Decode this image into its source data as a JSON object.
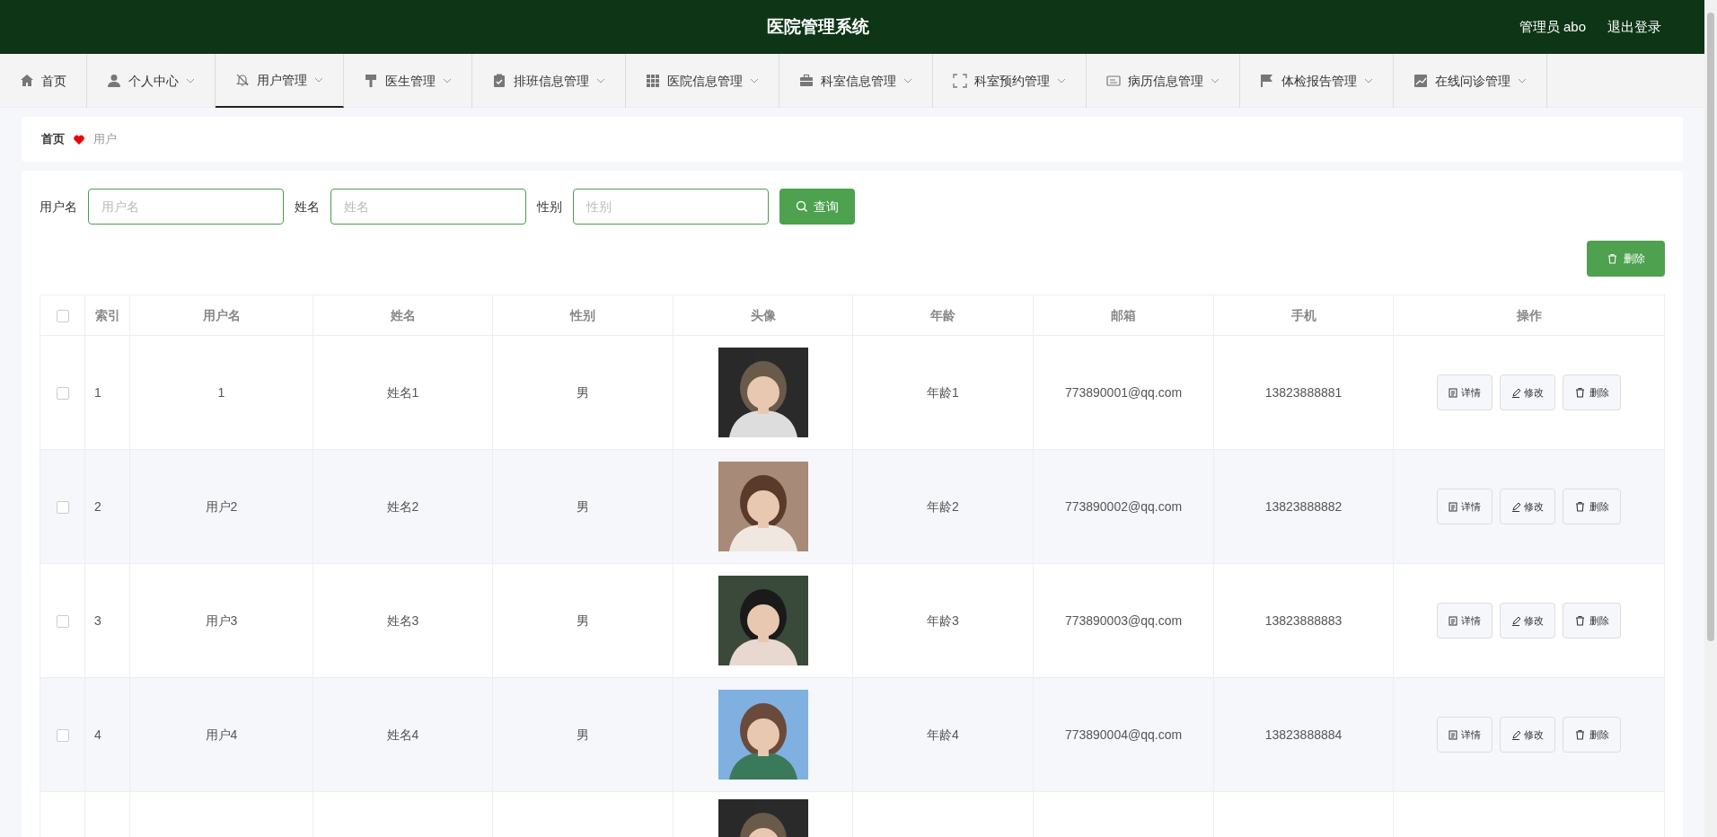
{
  "header": {
    "title": "医院管理系统",
    "user": "管理员 abo",
    "logout": "退出登录"
  },
  "nav": [
    {
      "label": "首页",
      "dropdown": false,
      "selected": false
    },
    {
      "label": "个人中心",
      "dropdown": true,
      "selected": false
    },
    {
      "label": "用户管理",
      "dropdown": true,
      "selected": true
    },
    {
      "label": "医生管理",
      "dropdown": true,
      "selected": false
    },
    {
      "label": "排班信息管理",
      "dropdown": true,
      "selected": false
    },
    {
      "label": "医院信息管理",
      "dropdown": true,
      "selected": false
    },
    {
      "label": "科室信息管理",
      "dropdown": true,
      "selected": false
    },
    {
      "label": "科室预约管理",
      "dropdown": true,
      "selected": false
    },
    {
      "label": "病历信息管理",
      "dropdown": true,
      "selected": false
    },
    {
      "label": "体检报告管理",
      "dropdown": true,
      "selected": false
    },
    {
      "label": "在线问诊管理",
      "dropdown": true,
      "selected": false
    }
  ],
  "breadcrumb": [
    "首页",
    "用户"
  ],
  "search": [
    {
      "label": "用户名",
      "placeholder": "用户名"
    },
    {
      "label": "姓名",
      "placeholder": "姓名"
    },
    {
      "label": "性别",
      "placeholder": "性别"
    }
  ],
  "search_button": "查询",
  "delete_button": "删除",
  "table": {
    "header_checked": false,
    "columns": [
      "索引",
      "用户名",
      "姓名",
      "性别",
      "头像",
      "年龄",
      "邮箱",
      "手机",
      "操作"
    ],
    "rows": [
      {
        "selected": false,
        "cells": [
          "1",
          "1",
          "姓名1",
          "男",
          null,
          "年龄1",
          "773890001@qq.com",
          "13823888881"
        ],
        "avatar": {
          "kind": "picture"
        },
        "actions": [
          "详情",
          "修改",
          "删除"
        ]
      },
      {
        "selected": false,
        "cells": [
          "2",
          "用户2",
          "姓名2",
          "男",
          null,
          "年龄2",
          "773890002@qq.com",
          "13823888882"
        ],
        "avatar": {
          "kind": "picture"
        },
        "actions": [
          "详情",
          "修改",
          "删除"
        ]
      },
      {
        "selected": false,
        "cells": [
          "3",
          "用户3",
          "姓名3",
          "男",
          null,
          "年龄3",
          "773890003@qq.com",
          "13823888883"
        ],
        "avatar": {
          "kind": "picture"
        },
        "actions": [
          "详情",
          "修改",
          "删除"
        ]
      },
      {
        "selected": false,
        "cells": [
          "4",
          "用户4",
          "姓名4",
          "男",
          null,
          "年龄4",
          "773890004@qq.com",
          "13823888884"
        ],
        "avatar": {
          "kind": "picture"
        },
        "actions": [
          "详情",
          "修改",
          "删除"
        ]
      },
      {
        "avatar": {
          "kind": "picture"
        }
      }
    ]
  }
}
